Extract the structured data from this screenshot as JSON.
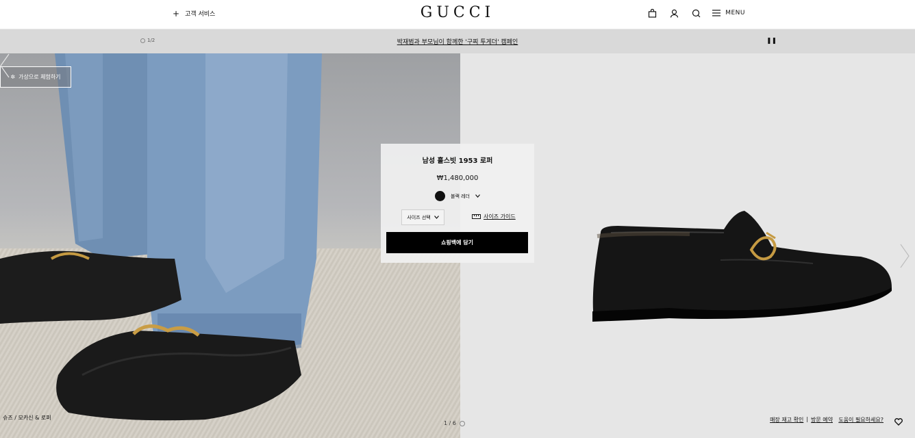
{
  "header": {
    "customer_service": "고객 서비스",
    "logo": "GUCCI",
    "menu_label": "MENU"
  },
  "announcement": {
    "counter": "1/2",
    "text": "박재범과 부모님이 함께한 '구찌 투게더' 캠페인"
  },
  "left": {
    "try_on": "가상으로 체험하기",
    "breadcrumb": "슈즈 / 모카신 & 로퍼"
  },
  "product": {
    "name": "남성 홀스빗 1953 로퍼",
    "price": "₩1,480,000",
    "color_name": "블랙 레더",
    "color_hex": "#111111",
    "size_select": "사이즈 선택",
    "size_guide": "사이즈 가이드",
    "add_to_bag": "쇼핑백에 담기"
  },
  "footer": {
    "pager": "1 / 6",
    "stock_check": "매장 재고 확인",
    "visit_booking": "방문 예약",
    "help": "도움이 필요하세요?"
  },
  "icons": [
    "plus-icon",
    "shopping-bag-icon",
    "user-icon",
    "search-icon",
    "menu-icon",
    "pause-icon",
    "sparkle-icon",
    "chevron-down-icon",
    "ruler-icon",
    "chevron-left-icon",
    "chevron-right-icon",
    "heart-icon"
  ]
}
